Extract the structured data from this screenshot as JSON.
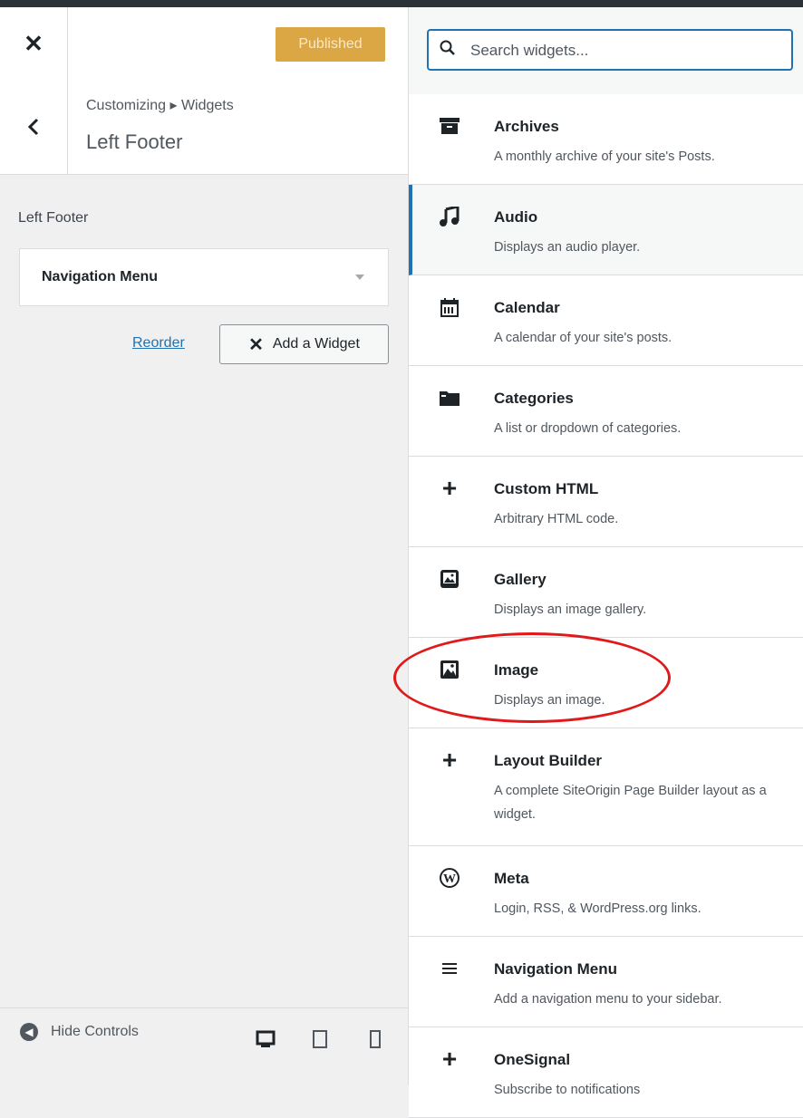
{
  "header": {
    "close_icon": "close-icon",
    "publish_label": "Published"
  },
  "section": {
    "breadcrumb": "Customizing ▸ Widgets",
    "title": "Left Footer"
  },
  "area": {
    "label": "Left Footer",
    "widgets": [
      {
        "title": "Navigation Menu"
      }
    ],
    "reorder_label": "Reorder",
    "add_label": "Add a Widget"
  },
  "footer": {
    "hide_label": "Hide Controls",
    "devices": [
      "desktop-icon",
      "tablet-icon",
      "mobile-icon"
    ]
  },
  "search": {
    "placeholder": "Search widgets..."
  },
  "widgets": [
    {
      "name": "Archives",
      "desc": "A monthly archive of your site's Posts.",
      "icon": "archive-icon"
    },
    {
      "name": "Audio",
      "desc": "Displays an audio player.",
      "icon": "music-icon"
    },
    {
      "name": "Calendar",
      "desc": "A calendar of your site's posts.",
      "icon": "calendar-icon"
    },
    {
      "name": "Categories",
      "desc": "A list or dropdown of categories.",
      "icon": "folder-icon"
    },
    {
      "name": "Custom HTML",
      "desc": "Arbitrary HTML code.",
      "icon": "plus-icon"
    },
    {
      "name": "Gallery",
      "desc": "Displays an image gallery.",
      "icon": "gallery-icon"
    },
    {
      "name": "Image",
      "desc": "Displays an image.",
      "icon": "image-icon"
    },
    {
      "name": "Layout Builder",
      "desc": "A complete SiteOrigin Page Builder layout as a widget.",
      "icon": "plus-icon"
    },
    {
      "name": "Meta",
      "desc": "Login, RSS, & WordPress.org links.",
      "icon": "wordpress-icon"
    },
    {
      "name": "Navigation Menu",
      "desc": "Add a navigation menu to your sidebar.",
      "icon": "menu-icon"
    },
    {
      "name": "OneSignal",
      "desc": "Subscribe to notifications",
      "icon": "plus-icon"
    }
  ],
  "colors": {
    "accent": "#2271b1",
    "publish": "#dba745",
    "annotation": "#e0191b"
  }
}
